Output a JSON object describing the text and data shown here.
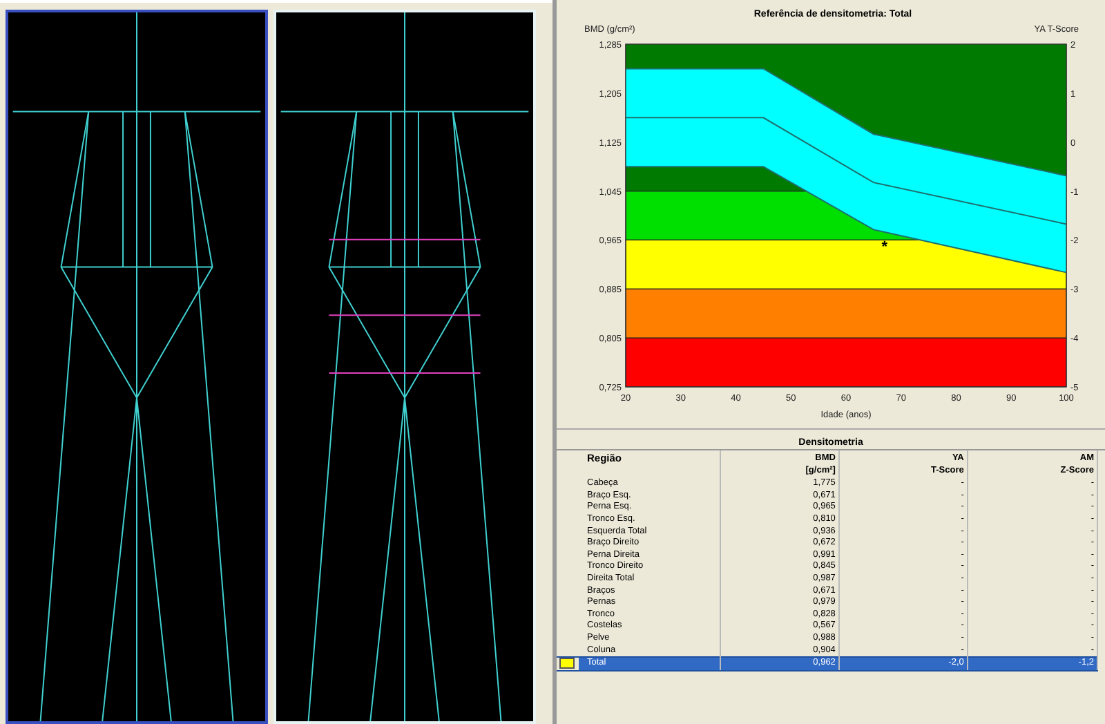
{
  "scans": [
    {
      "selected": true
    },
    {
      "selected": false
    }
  ],
  "chart": {
    "chart_data": {
      "type": "line",
      "title": "Referência de densitometria: Total",
      "xlabel": "Idade (anos)",
      "ylabel": "BMD (g/cm²)",
      "y2label": "YA T-Score",
      "x": [
        20,
        45,
        65,
        100
      ],
      "series": [
        {
          "color": "#1f6f6f",
          "values": [
            1.245,
            1.245,
            1.138,
            1.07
          ]
        },
        {
          "color": "#1f6f6f",
          "values": [
            1.165,
            1.165,
            1.059,
            0.991
          ]
        },
        {
          "color": "#1f6f6f",
          "values": [
            1.085,
            1.085,
            0.982,
            0.912
          ]
        }
      ],
      "xlim": [
        20,
        100
      ],
      "ylim": [
        0.725,
        1.285
      ],
      "xticks": [
        20,
        30,
        40,
        50,
        60,
        70,
        80,
        90,
        100
      ],
      "yticks": [
        {
          "value": 1.285,
          "label": "1,285"
        },
        {
          "value": 1.205,
          "label": "1,205"
        },
        {
          "value": 1.125,
          "label": "1,125"
        },
        {
          "value": 1.045,
          "label": "1,045"
        },
        {
          "value": 0.965,
          "label": "0,965"
        },
        {
          "value": 0.885,
          "label": "0,885"
        },
        {
          "value": 0.805,
          "label": "0,805"
        },
        {
          "value": 0.725,
          "label": "0,725"
        }
      ],
      "y2lim": [
        -5,
        2
      ],
      "y2ticks": [
        2,
        1,
        0,
        -1,
        -2,
        -3,
        -4,
        -5
      ],
      "annotations": [
        {
          "text": "*"
        }
      ]
    }
  },
  "table": {
    "title": "Densitometria",
    "columns": [
      "Região",
      "BMD\n[g/cm²]",
      "YA\nT-Score",
      "AM\nZ-Score"
    ],
    "rows": [
      {
        "cells": [
          "Cabeça",
          "1,775",
          "-",
          "-"
        ],
        "selected": false
      },
      {
        "cells": [
          "Braço Esq.",
          "0,671",
          "-",
          "-"
        ],
        "selected": false
      },
      {
        "cells": [
          "Perna Esq.",
          "0,965",
          "-",
          "-"
        ],
        "selected": false
      },
      {
        "cells": [
          "Tronco Esq.",
          "0,810",
          "-",
          "-"
        ],
        "selected": false
      },
      {
        "cells": [
          "Esquerda Total",
          "0,936",
          "-",
          "-"
        ],
        "selected": false
      },
      {
        "cells": [
          "Braço Direito",
          "0,672",
          "-",
          "-"
        ],
        "selected": false
      },
      {
        "cells": [
          "Perna Direita",
          "0,991",
          "-",
          "-"
        ],
        "selected": false
      },
      {
        "cells": [
          "Tronco Direito",
          "0,845",
          "-",
          "-"
        ],
        "selected": false
      },
      {
        "cells": [
          "Direita Total",
          "0,987",
          "-",
          "-"
        ],
        "selected": false
      },
      {
        "cells": [
          "Braços",
          "0,671",
          "-",
          "-"
        ],
        "selected": false
      },
      {
        "cells": [
          "Pernas",
          "0,979",
          "-",
          "-"
        ],
        "selected": false
      },
      {
        "cells": [
          "Tronco",
          "0,828",
          "-",
          "-"
        ],
        "selected": false
      },
      {
        "cells": [
          "Costelas",
          "0,567",
          "-",
          "-"
        ],
        "selected": false
      },
      {
        "cells": [
          "Pelve",
          "0,988",
          "-",
          "-"
        ],
        "selected": false
      },
      {
        "cells": [
          "Coluna",
          "0,904",
          "-",
          "-"
        ],
        "selected": false
      },
      {
        "cells": [
          "Total",
          "0,962",
          "-2,0",
          "-1,2"
        ],
        "selected": true,
        "color": "#ffff00"
      }
    ]
  }
}
